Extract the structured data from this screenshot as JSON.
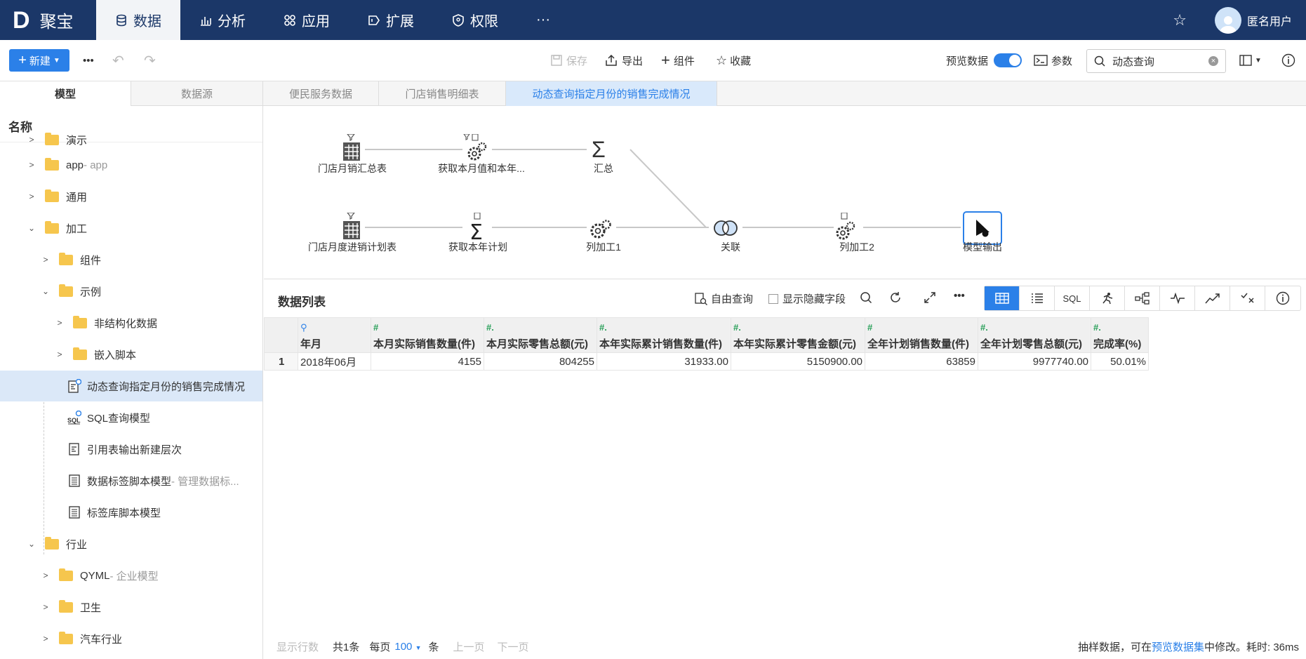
{
  "app": {
    "logo_letter": "D",
    "logo_text": "聚宝"
  },
  "nav": [
    {
      "label": "数据",
      "icon": "database-icon",
      "active": true
    },
    {
      "label": "分析",
      "icon": "bar-chart-icon"
    },
    {
      "label": "应用",
      "icon": "apps-icon"
    },
    {
      "label": "扩展",
      "icon": "extension-icon"
    },
    {
      "label": "权限",
      "icon": "shield-icon"
    },
    {
      "label": "···",
      "icon": "more-icon"
    }
  ],
  "user": {
    "name": "匿名用户"
  },
  "toolbar": {
    "new_label": "新建",
    "more": "•••",
    "save": "保存",
    "export": "导出",
    "component": "组件",
    "favorite": "收藏",
    "preview_label": "预览数据",
    "params": "参数",
    "search_value": "动态查询"
  },
  "tabs": [
    "模型",
    "数据源",
    "便民服务数据",
    "门店销售明细表",
    "动态查询指定月份的销售完成情况"
  ],
  "sidebar": {
    "header": "名称",
    "items": [
      {
        "label": "演示",
        "sub": ""
      },
      {
        "label": "app",
        "sub": " - app"
      },
      {
        "label": "通用",
        "sub": ""
      },
      {
        "label": "加工",
        "sub": ""
      },
      {
        "label": "组件",
        "sub": ""
      },
      {
        "label": "示例",
        "sub": ""
      },
      {
        "label": "非结构化数据",
        "sub": ""
      },
      {
        "label": "嵌入脚本",
        "sub": ""
      },
      {
        "label": "动态查询指定月份的销售完成情况",
        "sub": ""
      },
      {
        "label": "SQL查询模型",
        "sub": ""
      },
      {
        "label": "引用表输出新建层次",
        "sub": ""
      },
      {
        "label": "数据标签脚本模型",
        "sub": " - 管理数据标..."
      },
      {
        "label": "标签库脚本模型",
        "sub": ""
      },
      {
        "label": "行业",
        "sub": ""
      },
      {
        "label": "QYML",
        "sub": " - 企业模型"
      },
      {
        "label": "卫生",
        "sub": ""
      },
      {
        "label": "汽车行业",
        "sub": ""
      }
    ]
  },
  "flow": {
    "nodes": [
      "门店月销汇总表",
      "获取本月值和本年...",
      "汇总",
      "门店月度进销计划表",
      "获取本年计划",
      "列加工1",
      "关联",
      "列加工2",
      "模型输出"
    ]
  },
  "datalist": {
    "title": "数据列表",
    "free_query": "自由查询",
    "show_hidden": "显示隐藏字段",
    "view_sql": "SQL",
    "columns": [
      "年月",
      "本月实际销售数量(件)",
      "本月实际零售总额(元)",
      "本年实际累计销售数量(件)",
      "本年实际累计零售金额(元)",
      "全年计划销售数量(件)",
      "全年计划零售总额(元)",
      "完成率(%)"
    ],
    "rows": [
      {
        "index": "1",
        "cells": [
          "2018年06月",
          "4155",
          "804255",
          "31933.00",
          "5150900.00",
          "63859",
          "9977740.00",
          "50.01%"
        ]
      }
    ]
  },
  "footer": {
    "show_rows": "显示行数",
    "total": "共1条",
    "per_page": "每页",
    "page_size": "100",
    "unit": "条",
    "prev": "上一页",
    "next": "下一页",
    "note_pre": "抽样数据，可在",
    "note_link": "预览数据集",
    "note_post": "中修改。耗时: 36ms"
  },
  "colors": {
    "primary": "#2b80e8",
    "header_bg": "#1b3768",
    "folder": "#f6c64d"
  }
}
